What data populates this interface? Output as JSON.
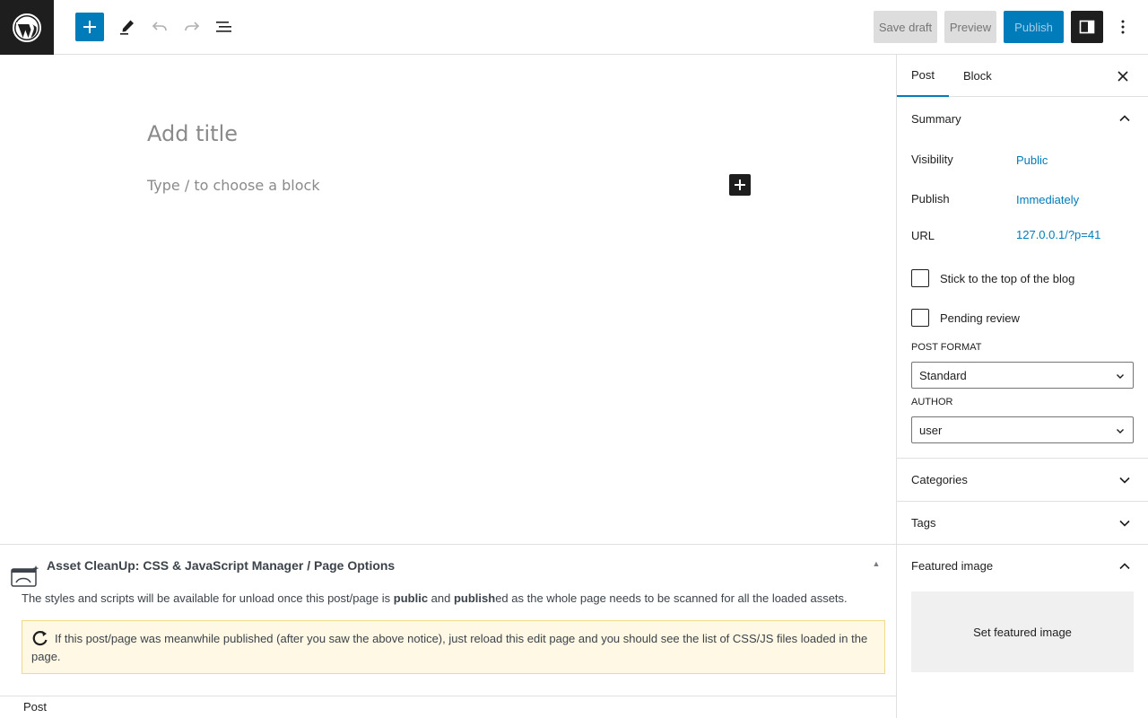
{
  "toolbar": {
    "save_draft": "Save draft",
    "preview": "Preview",
    "publish": "Publish"
  },
  "editor": {
    "title_placeholder": "Add title",
    "block_placeholder": "Type / to choose a block"
  },
  "metabox": {
    "title": "Asset CleanUp: CSS & JavaScript Manager / Page Options",
    "text_prefix": "The styles and scripts will be available for unload once this post/page is ",
    "text_bold1": "public",
    "text_mid": " and ",
    "text_bold2": "publish",
    "text_suffix": "ed as the whole page needs to be scanned for all the loaded assets.",
    "notice": "If this post/page was meanwhile published (after you saw the above notice), just reload this edit page and you should see the list of CSS/JS files loaded in the page."
  },
  "footer": {
    "breadcrumb": "Post"
  },
  "sidebar": {
    "tabs": [
      "Post",
      "Block"
    ],
    "summary": {
      "title": "Summary",
      "visibility_label": "Visibility",
      "visibility_value": "Public",
      "publish_label": "Publish",
      "publish_value": "Immediately",
      "url_label": "URL",
      "url_value": "127.0.0.1/?p=41",
      "stick_label": "Stick to the top of the blog",
      "pending_label": "Pending review",
      "post_format_label": "POST FORMAT",
      "post_format_value": "Standard",
      "author_label": "AUTHOR",
      "author_value": "user"
    },
    "categories": "Categories",
    "tags": "Tags",
    "featured_image": "Featured image",
    "set_featured_image": "Set featured image"
  },
  "colors": {
    "accent": "#007cba",
    "dark": "#1e1e1e",
    "notice_bg": "#fff8e5"
  }
}
